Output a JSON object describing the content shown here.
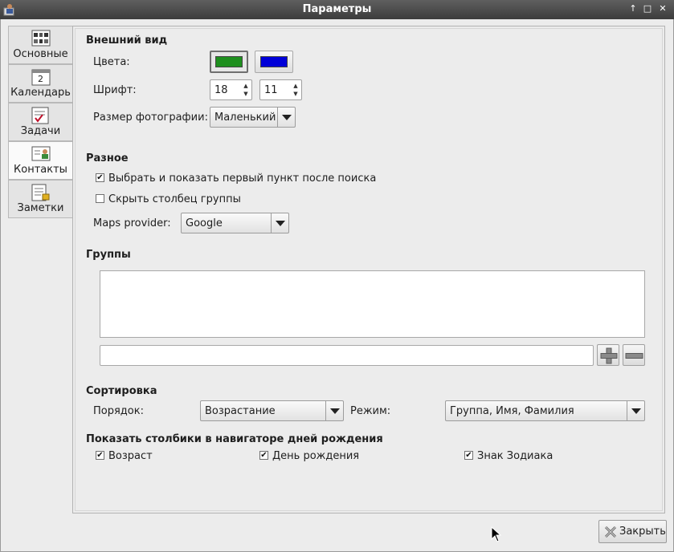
{
  "window": {
    "title": "Параметры",
    "controls": [
      "↑",
      "□",
      "✕"
    ]
  },
  "tabs": [
    {
      "label": "Основные",
      "icon": "general-settings-icon",
      "active": false
    },
    {
      "label": "Календарь",
      "icon": "calendar-icon",
      "day": "2",
      "active": false
    },
    {
      "label": "Задачи",
      "icon": "tasks-icon",
      "active": false
    },
    {
      "label": "Контакты",
      "icon": "contacts-icon",
      "active": true
    },
    {
      "label": "Заметки",
      "icon": "notes-icon",
      "active": false
    }
  ],
  "appearance": {
    "heading": "Внешний вид",
    "colors_label": "Цвета:",
    "color1": "#1e8f1e",
    "color2": "#0000d8",
    "font_label": "Шрифт:",
    "font_size1": "18",
    "font_size2": "11",
    "photo_size_label": "Размер фотографии:",
    "photo_size_value": "Маленький"
  },
  "misc": {
    "heading": "Разное",
    "option1_label": "Выбрать и показать первый пункт после поиска",
    "option1_checked": true,
    "option2_label": "Скрыть столбец группы",
    "option2_checked": false,
    "maps_label": "Maps provider:",
    "maps_value": "Google"
  },
  "groups": {
    "heading": "Группы",
    "items": [],
    "input_value": ""
  },
  "sorting": {
    "heading": "Сортировка",
    "order_label": "Порядок:",
    "order_value": "Возрастание",
    "mode_label": "Режим:",
    "mode_value": "Группа, Имя, Фамилия"
  },
  "birthday_columns": {
    "heading": "Показать столбики в навигаторе дней рождения",
    "age_label": "Возраст",
    "age_checked": true,
    "birthday_label": "День рождения",
    "birthday_checked": true,
    "zodiac_label": "Знак Зодиака",
    "zodiac_checked": true
  },
  "footer": {
    "close_label": "Закрыть"
  }
}
